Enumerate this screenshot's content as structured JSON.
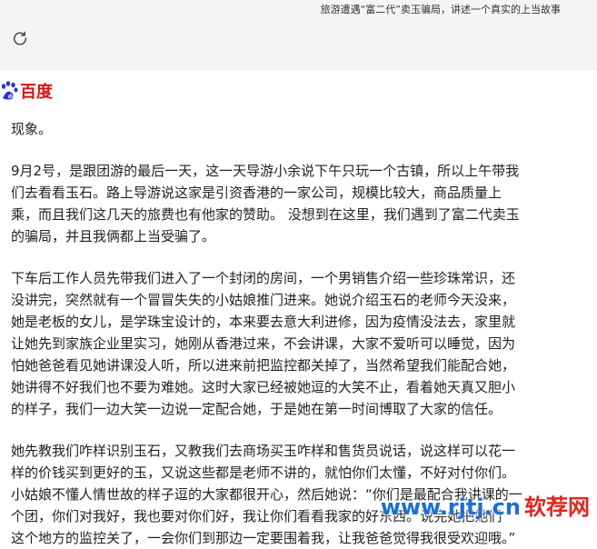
{
  "browser": {
    "page_title": "旅游遭遇“富二代”卖玉骗局，讲述一个真实的上当故事",
    "reload_icon": "reload-icon"
  },
  "header": {
    "logo_text": "百度",
    "logo_icon": "baidu-paw-icon",
    "brand_color": "#de0f17"
  },
  "article": {
    "partial_top": "现象。",
    "paragraphs": [
      [
        "9月2号，是跟团游的最后一天，这一天导游小余说下午只玩一个古镇，所以上午带我",
        "们去看看玉石。路上导游说这家是引资香港的一家公司，规模比较大，商品质量上",
        "乘，而且我们这几天的旅费也有他家的赞助。 没想到在这里，我们遇到了富二代卖玉",
        "的骗局，并且我俩都上当受骗了。"
      ],
      [
        "下车后工作人员先带我们进入了一个封闭的房间，一个男销售介绍一些珍珠常识，还",
        "没讲完，突然就有一个冒冒失失的小姑娘推门进来。她说介绍玉石的老师今天没来，",
        "她是老板的女儿，是学珠宝设计的，本来要去意大利进修，因为疫情没法去，家里就",
        "让她先到家族企业里实习，她刚从香港过来，不会讲课，大家不爱听可以睡觉，因为",
        "怕她爸爸看见她讲课没人听，所以进来前把监控都关掉了，当然希望我们能配合她，",
        "她讲得不好我们也不要为难她。这时大家已经被她逗的大笑不止，看着她天真又胆小",
        "的样子，我们一边大笑一边说一定配合她，于是她在第一时间博取了大家的信任。"
      ],
      [
        "她先教我们咋样识别玉石，又教我们去商场买玉咋样和售货员说话，说这样可以花一",
        "样的价钱买到更好的玉，又说这些都是老师不讲的，就怕你们太懂，不好对付你们。",
        "小姑娘不懂人情世故的样子逗的大家都很开心，然后她说：“你们是最配合我讲课的一",
        "个团，你们对我好，我也要对你们好，我让你们看看我家的好东西。”说完她把她们",
        "这个地方的监控关了，一会你们到那边一定要围着我，让我爸爸觉得我很受欢迎哦。”"
      ]
    ]
  },
  "watermark": {
    "url": "www.rjtj.cn",
    "name": "软荐网",
    "url_color": "#1a6fd6",
    "name_color": "#e0261e"
  }
}
